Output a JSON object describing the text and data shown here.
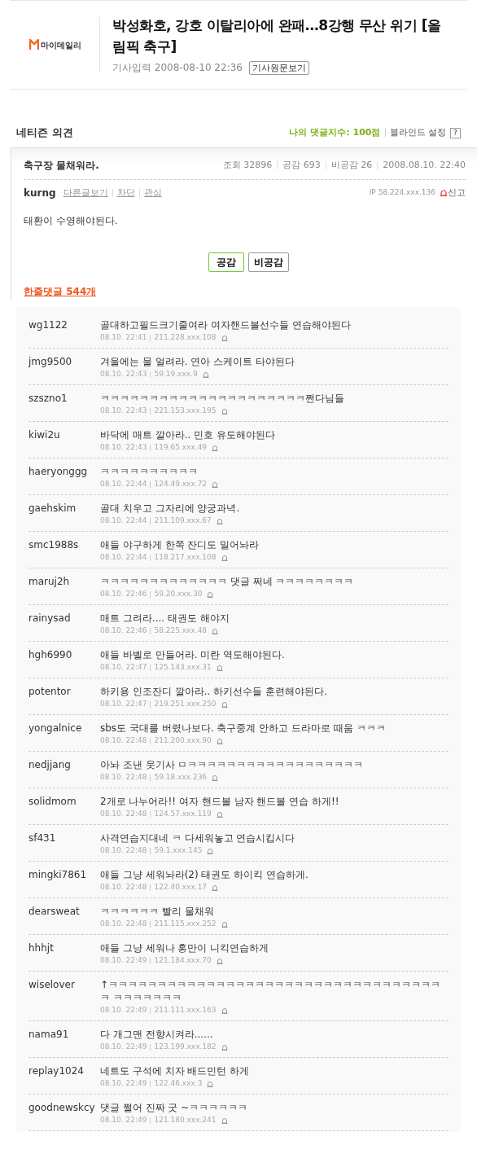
{
  "article": {
    "source": "마이데일리",
    "title": "박성화호, 강호 이탈리아에 완패…8강행 무산 위기 [올림픽 축구]",
    "date_label": "기사입력",
    "date": "2008-08-10 22:36",
    "original_button": "기사원문보기"
  },
  "opinions": {
    "heading": "네티즌 의견",
    "my_score": "나의 댓글지수: 100점",
    "blind_setting": "블라인드 설정",
    "help": "?"
  },
  "best_comment": {
    "title": "축구장 물채워라.",
    "stats": [
      "조회 32896",
      "공감 693",
      "비공감 26",
      "2008.08.10. 22:40"
    ],
    "author": "kurng",
    "links": [
      "다른글보기",
      "차단",
      "관심"
    ],
    "ip": "IP 58.224.xxx.136",
    "report": "신고",
    "body": "태환이 수영해야된다.",
    "agree": "공감",
    "disagree": "비공감"
  },
  "replies_link": "한줄댓글 544개",
  "replies": [
    {
      "user": "wg1122",
      "text": "골대하고필드크기줄여라 여자핸드볼선수들 연습해야된다",
      "time": "08.10. 22:41",
      "ip": "211.228.xxx.108"
    },
    {
      "user": "jmg9500",
      "text": "겨울에는 물 얼려라. 연아 스케이트 타야된다",
      "time": "08.10. 22:43",
      "ip": "59.19.xxx.9"
    },
    {
      "user": "szszno1",
      "text": "ㅋㅋㅋㅋㅋㅋㅋㅋㅋㅋㅋㅋㅋㅋㅋㅋㅋㅋㅋㅋㅋ쩐다님들",
      "time": "08.10. 22:43",
      "ip": "221.153.xxx.195"
    },
    {
      "user": "kiwi2u",
      "text": "바닥에 매트 깔아라.. 민호 유도해야된다",
      "time": "08.10. 22:43",
      "ip": "119.65.xxx.49"
    },
    {
      "user": "haeryonggg",
      "text": "ㅋㅋㅋㅋㅋㅋㅋㅋㅋㅋ",
      "time": "08.10. 22:44",
      "ip": "124.49.xxx.72"
    },
    {
      "user": "gaehskim",
      "text": "골대 치우고 그자리에 양궁과녁.",
      "time": "08.10. 22:44",
      "ip": "211.109.xxx.67"
    },
    {
      "user": "smc1988s",
      "text": "애들 야구하게 한쪽 잔디도 밀어놔라",
      "time": "08.10. 22:44",
      "ip": "118.217.xxx.108"
    },
    {
      "user": "maruj2h",
      "text": "ㅋㅋㅋㅋㅋㅋㅋㅋㅋㅋㅋㅋㅋ 댓글 쩌네 ㅋㅋㅋㅋㅋㅋㅋㅋ",
      "time": "08.10. 22:46",
      "ip": "59.20.xxx.30"
    },
    {
      "user": "rainysad",
      "text": "매트 그려라.... 태권도 해야지",
      "time": "08.10. 22:46",
      "ip": "58.225.xxx.48"
    },
    {
      "user": "hgh6990",
      "text": "애들 바벨로 만들어라. 미란 역도해야된다.",
      "time": "08.10. 22:47",
      "ip": "125.143.xxx.31"
    },
    {
      "user": "potentor",
      "text": "하키용 인조잔디 깔아라.. 하키선수들 훈련해야된다.",
      "time": "08.10. 22:47",
      "ip": "219.251.xxx.250"
    },
    {
      "user": "yongalnice",
      "text": "sbs도 국대를 버렸나보다. 축구중계 안하고 드라마로 때움 ㅋㅋㅋ",
      "time": "08.10. 22:48",
      "ip": "211.200.xxx.90"
    },
    {
      "user": "nedjjang",
      "text": "아놔 조낸 웃기사 ㅁㅋㅋㅋㅋㅋㅋㅋㅋㅋㅋㅋㅋㅋㅋㅋㅋㅋㅋ",
      "time": "08.10. 22:48",
      "ip": "59.18.xxx.236"
    },
    {
      "user": "solidmom",
      "text": "2개로 나누어라!! 여자 핸드볼 남자 핸드볼 연습 하게!!",
      "time": "08.10. 22:48",
      "ip": "124.57.xxx.119"
    },
    {
      "user": "sf431",
      "text": "사격연습지대네 ㅋ 다세워놓고 연습시킵시다",
      "time": "08.10. 22:48",
      "ip": "59.1.xxx.145"
    },
    {
      "user": "mingki7861",
      "text": "애들 그냥 세워놔라(2) 태권도 하이킥 연습하게.",
      "time": "08.10. 22:48",
      "ip": "122.40.xxx.17"
    },
    {
      "user": "dearsweat",
      "text": "ㅋㅋㅋㅋㅋㅋ 빨리 물채워",
      "time": "08.10. 22:48",
      "ip": "211.115.xxx.252"
    },
    {
      "user": "hhhjt",
      "text": "애들 그냥 세워나 홍만이 니킥연습하게",
      "time": "08.10. 22:49",
      "ip": "121.184.xxx.70"
    },
    {
      "user": "wiselover",
      "text": "↑ㅋㅋㅋㅋㅋㅋㅋㅋㅋㅋㅋㅋㅋㅋㅋㅋㅋㅋㅋㅋㅋㅋㅋㅋㅋㅋㅋㅋㅋㅋㅋㅋㅋㅋㅋ ㅋㅋㅋㅋㅋㅋㅋ",
      "time": "08.10. 22:49",
      "ip": "211.111.xxx.163"
    },
    {
      "user": "nama91",
      "text": "다 개그맨 전향시켜라......",
      "time": "08.10. 22:49",
      "ip": "123.199.xxx.182"
    },
    {
      "user": "replay1024",
      "text": "네트도 구석에 치자 배드민턴 하게",
      "time": "08.10. 22:49",
      "ip": "122.46.xxx.3"
    },
    {
      "user": "goodnewskcy",
      "text": "댓글 쩔어 진짜 굿 ~ㅋㅋㅋㅋㅋㅋ",
      "time": "08.10. 22:49",
      "ip": "121.180.xxx.241"
    }
  ]
}
